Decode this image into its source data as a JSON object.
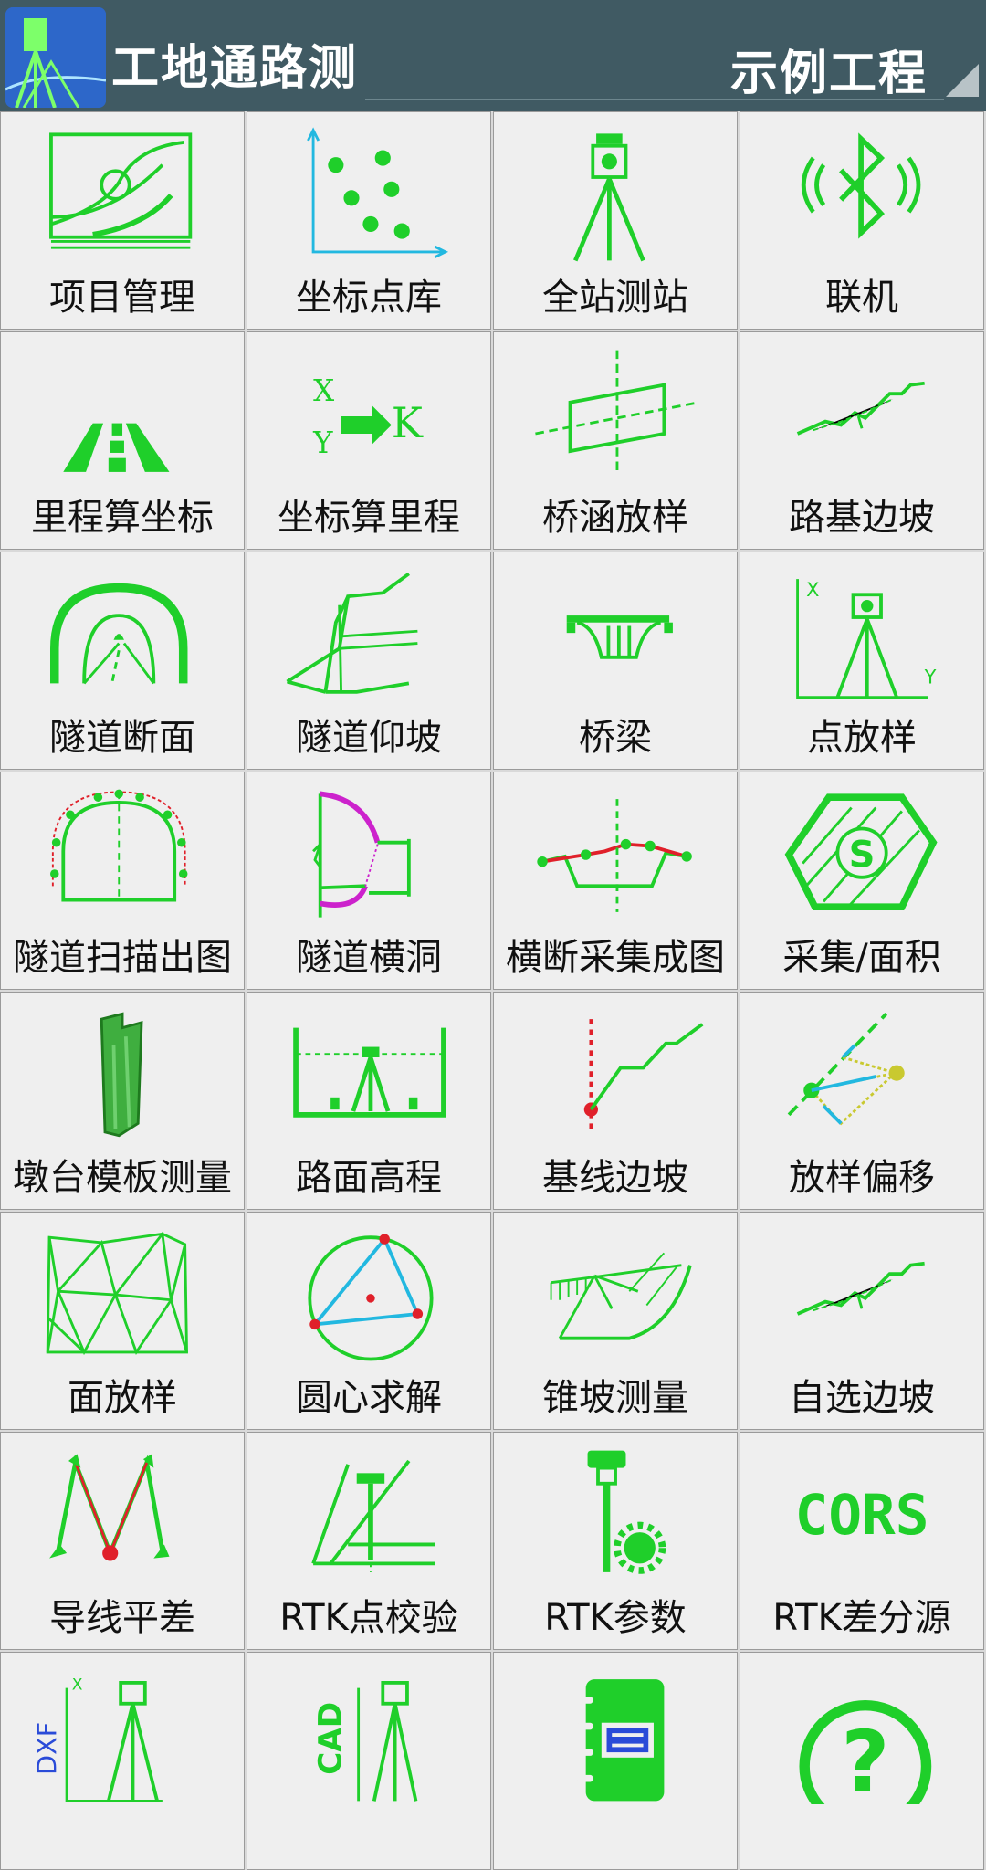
{
  "header": {
    "app_title": "工地通路测",
    "project_name": "示例工程"
  },
  "menu": [
    {
      "label": "项目管理",
      "icon": "project-management-icon"
    },
    {
      "label": "坐标点库",
      "icon": "coordinate-library-icon"
    },
    {
      "label": "全站测站",
      "icon": "total-station-icon"
    },
    {
      "label": "联机",
      "icon": "bluetooth-icon"
    },
    {
      "label": "里程算坐标",
      "icon": "road-icon"
    },
    {
      "label": "坐标算里程",
      "icon": "xy-to-k-icon"
    },
    {
      "label": "桥涵放样",
      "icon": "culvert-icon"
    },
    {
      "label": "路基边坡",
      "icon": "slope-icon"
    },
    {
      "label": "隧道断面",
      "icon": "tunnel-section-icon"
    },
    {
      "label": "隧道仰坡",
      "icon": "tunnel-slope-icon"
    },
    {
      "label": "桥梁",
      "icon": "bridge-icon"
    },
    {
      "label": "点放样",
      "icon": "point-stakeout-icon"
    },
    {
      "label": "隧道扫描出图",
      "icon": "tunnel-scan-icon"
    },
    {
      "label": "隧道横洞",
      "icon": "cross-tunnel-icon"
    },
    {
      "label": "横断采集成图",
      "icon": "cross-section-icon"
    },
    {
      "label": "采集/面积",
      "icon": "area-icon"
    },
    {
      "label": "墩台模板测量",
      "icon": "pier-template-icon"
    },
    {
      "label": "路面高程",
      "icon": "road-elevation-icon"
    },
    {
      "label": "基线边坡",
      "icon": "baseline-slope-icon"
    },
    {
      "label": "放样偏移",
      "icon": "stakeout-offset-icon"
    },
    {
      "label": "面放样",
      "icon": "surface-stakeout-icon"
    },
    {
      "label": "圆心求解",
      "icon": "circle-center-icon"
    },
    {
      "label": "锥坡测量",
      "icon": "cone-slope-icon"
    },
    {
      "label": "自选边坡",
      "icon": "custom-slope-icon"
    },
    {
      "label": "导线平差",
      "icon": "traverse-adjustment-icon"
    },
    {
      "label": "RTK点校验",
      "icon": "rtk-check-icon"
    },
    {
      "label": "RTK参数",
      "icon": "rtk-params-icon"
    },
    {
      "label": "RTK差分源",
      "icon": "cors-icon"
    },
    {
      "label": "",
      "icon": "dxf-stakeout-icon"
    },
    {
      "label": "",
      "icon": "cad-stakeout-icon"
    },
    {
      "label": "",
      "icon": "notebook-icon"
    },
    {
      "label": "",
      "icon": "help-icon"
    }
  ],
  "icon_text": {
    "cors": "CORS",
    "dxf": "DXF",
    "cad": "CAD",
    "s": "S",
    "x": "X",
    "y": "Y",
    "k": "K",
    "q": "?"
  },
  "colors": {
    "header_bg": "#405a63",
    "icon_green": "#1fcf2a",
    "cell_bg": "#efefef",
    "accent_red": "#e0202a",
    "accent_magenta": "#cc22cc",
    "accent_cyan": "#22b8e0",
    "accent_blue": "#2a4bd8"
  }
}
